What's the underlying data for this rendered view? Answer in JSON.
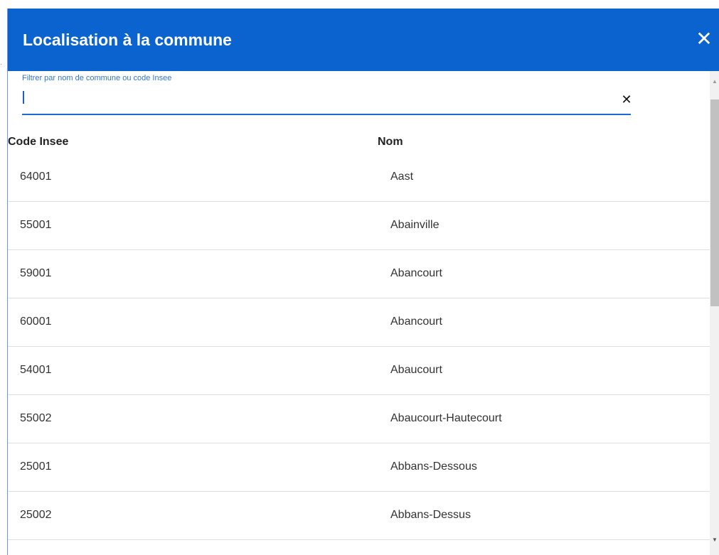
{
  "dialog": {
    "title": "Localisation à la commune",
    "close_icon": "close-icon"
  },
  "filter": {
    "label": "Filtrer par nom de commune ou code Insee",
    "value": "",
    "clear_icon": "clear-icon"
  },
  "table": {
    "columns": [
      "Code Insee",
      "Nom"
    ],
    "rows": [
      {
        "code": "64001",
        "nom": "Aast"
      },
      {
        "code": "55001",
        "nom": "Abainville"
      },
      {
        "code": "59001",
        "nom": "Abancourt"
      },
      {
        "code": "60001",
        "nom": "Abancourt"
      },
      {
        "code": "54001",
        "nom": "Abaucourt"
      },
      {
        "code": "55002",
        "nom": "Abaucourt-Hautecourt"
      },
      {
        "code": "25001",
        "nom": "Abbans-Dessous"
      },
      {
        "code": "25002",
        "nom": "Abbans-Dessus"
      }
    ]
  },
  "colors": {
    "header_bg": "#0a63cf",
    "accent": "#1c6ad2"
  }
}
